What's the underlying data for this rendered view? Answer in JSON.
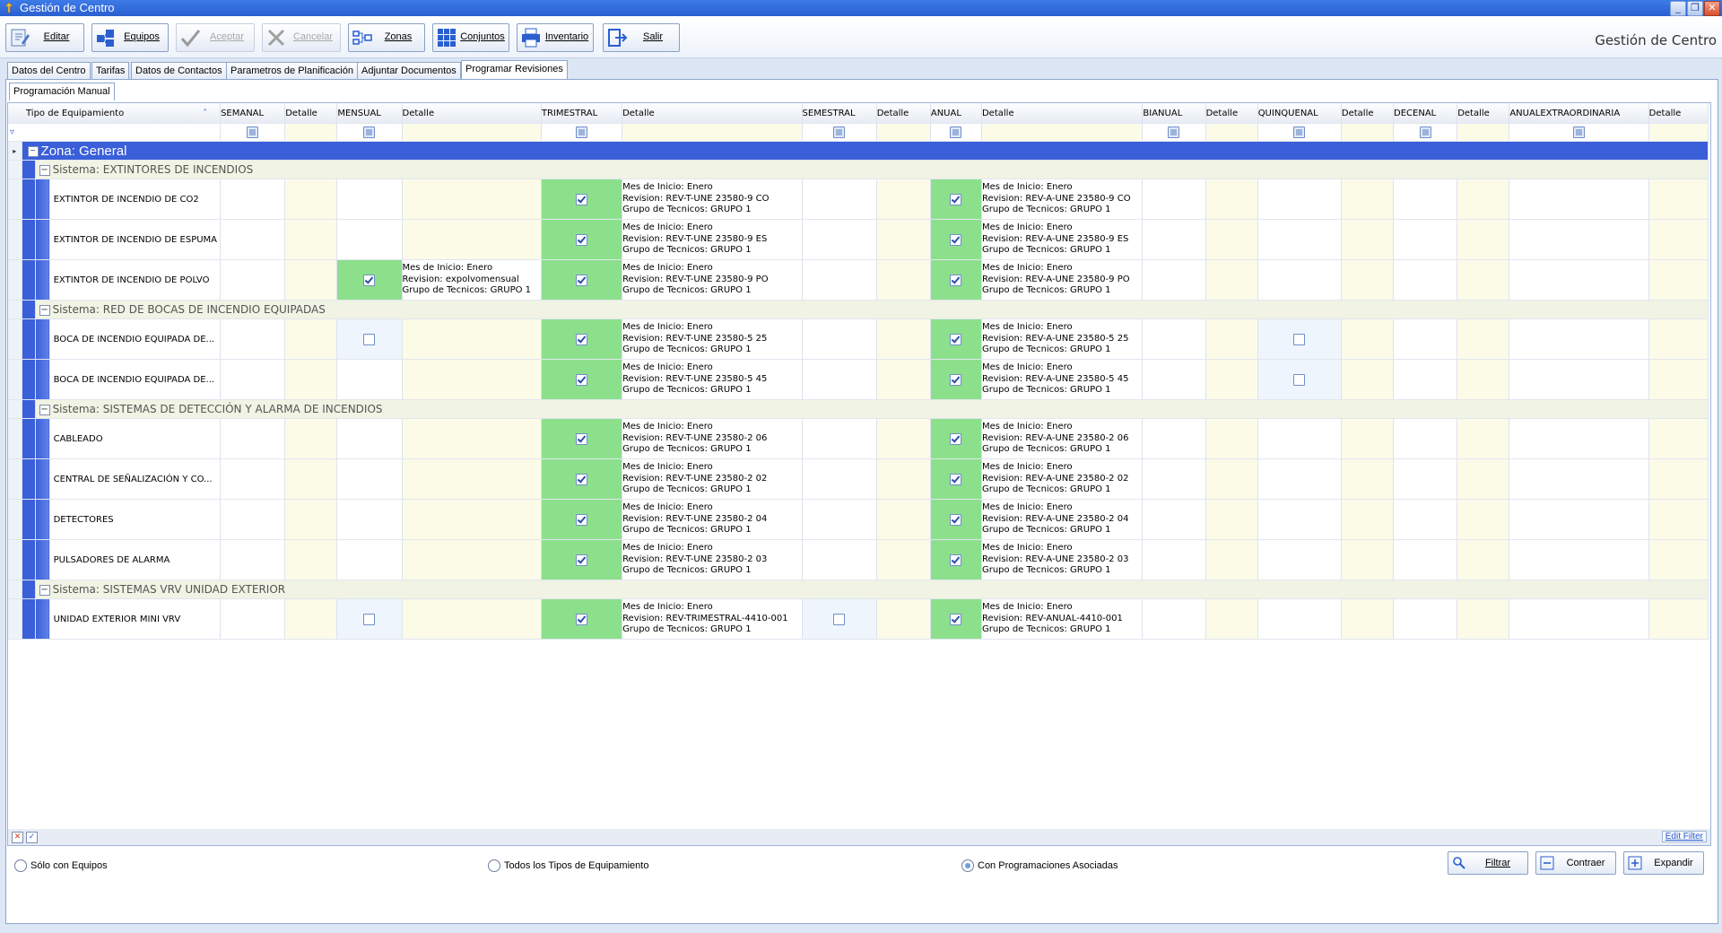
{
  "window": {
    "title": "Gestión de Centro",
    "app_heading": "Gestión de Centro"
  },
  "toolbar": [
    {
      "key": "editar",
      "label": "Editar",
      "icon": "edit-icon",
      "enabled": true
    },
    {
      "key": "equipos",
      "label": "Equipos",
      "icon": "equipment-icon",
      "enabled": true
    },
    {
      "key": "aceptar",
      "label": "Aceptar",
      "icon": "check-icon",
      "enabled": false
    },
    {
      "key": "cancelar",
      "label": "Cancelar",
      "icon": "cancel-icon",
      "enabled": false
    },
    {
      "key": "zonas",
      "label": "Zonas",
      "icon": "zones-icon",
      "enabled": true
    },
    {
      "key": "conjuntos",
      "label": "Conjuntos",
      "icon": "grid-icon",
      "enabled": true
    },
    {
      "key": "inventario",
      "label": "Inventario",
      "icon": "printer-icon",
      "enabled": true
    },
    {
      "key": "salir",
      "label": "Salir",
      "icon": "exit-icon",
      "enabled": true
    }
  ],
  "tabs": [
    "Datos del Centro",
    "Tarifas",
    "Datos de Contactos",
    "Parametros de Planificación",
    "Adjuntar Documentos",
    "Programar Revisiones"
  ],
  "active_tab": "Programar Revisiones",
  "subtab": "Programación Manual",
  "grid": {
    "headers": {
      "tipo": "Tipo de Equipamiento",
      "semanal": "SEMANAL",
      "semanal_det": "Detalle",
      "mensual": "MENSUAL",
      "mensual_det": "Detalle",
      "trimestral": "TRIMESTRAL",
      "trimestral_det": "Detalle",
      "semestral": "SEMESTRAL",
      "semestral_det": "Detalle",
      "anual": "ANUAL",
      "anual_det": "Detalle",
      "bianual": "BIANUAL",
      "bianual_det": "Detalle",
      "quinquenal": "QUINQUENAL",
      "quinquenal_det": "Detalle",
      "decenal": "DECENAL",
      "decenal_det": "Detalle",
      "anualextra": "ANUALEXTRAORDINARIA",
      "anualextra_det": "Detalle"
    },
    "zone": "Zona: General",
    "systems": [
      "Sistema: EXTINTORES DE INCENDIOS",
      "Sistema: RED DE BOCAS DE INCENDIO EQUIPADAS",
      "Sistema: SISTEMAS DE DETECCIÓN Y ALARMA DE INCENDIOS",
      "Sistema: SISTEMAS VRV UNIDAD EXTERIOR"
    ],
    "rows": [
      {
        "name": "EXTINTOR DE INCENDIO DE CO2",
        "trimestral": [
          "Mes de Inicio: Enero",
          "Revision: REV-T-UNE 23580-9 CO",
          "Grupo de Tecnicos: GRUPO 1"
        ],
        "anual": [
          "Mes de Inicio: Enero",
          "Revision: REV-A-UNE 23580-9 CO",
          "Grupo de Tecnicos: GRUPO 1"
        ]
      },
      {
        "name": "EXTINTOR DE INCENDIO DE ESPUMA",
        "trimestral": [
          "Mes de Inicio: Enero",
          "Revision: REV-T-UNE 23580-9 ES",
          "Grupo de Tecnicos: GRUPO 1"
        ],
        "anual": [
          "Mes de Inicio: Enero",
          "Revision: REV-A-UNE 23580-9 ES",
          "Grupo de Tecnicos: GRUPO 1"
        ]
      },
      {
        "name": "EXTINTOR DE INCENDIO DE POLVO",
        "mensual": [
          "Mes de Inicio: Enero",
          "Revision: expolvomensual",
          "Grupo de Tecnicos: GRUPO 1"
        ],
        "trimestral": [
          "Mes de Inicio: Enero",
          "Revision: REV-T-UNE 23580-9 PO",
          "Grupo de Tecnicos: GRUPO 1"
        ],
        "anual": [
          "Mes de Inicio: Enero",
          "Revision: REV-A-UNE 23580-9 PO",
          "Grupo de Tecnicos: GRUPO 1"
        ]
      },
      {
        "name": "BOCA DE INCENDIO EQUIPADA DE...",
        "trimestral": [
          "Mes de Inicio: Enero",
          "Revision: REV-T-UNE 23580-5 25",
          "Grupo de Tecnicos: GRUPO 1"
        ],
        "anual": [
          "Mes de Inicio: Enero",
          "Revision: REV-A-UNE 23580-5 25",
          "Grupo de Tecnicos: GRUPO 1"
        ]
      },
      {
        "name": "BOCA DE INCENDIO EQUIPADA DE...",
        "trimestral": [
          "Mes de Inicio: Enero",
          "Revision: REV-T-UNE 23580-5 45",
          "Grupo de Tecnicos: GRUPO 1"
        ],
        "anual": [
          "Mes de Inicio: Enero",
          "Revision: REV-A-UNE 23580-5 45",
          "Grupo de Tecnicos: GRUPO 1"
        ]
      },
      {
        "name": "CABLEADO",
        "trimestral": [
          "Mes de Inicio: Enero",
          "Revision: REV-T-UNE 23580-2 06",
          "Grupo de Tecnicos: GRUPO 1"
        ],
        "anual": [
          "Mes de Inicio: Enero",
          "Revision: REV-A-UNE 23580-2 06",
          "Grupo de Tecnicos: GRUPO 1"
        ]
      },
      {
        "name": "CENTRAL DE SEÑALIZACIÓN Y CO...",
        "trimestral": [
          "Mes de Inicio: Enero",
          "Revision: REV-T-UNE 23580-2 02",
          "Grupo de Tecnicos: GRUPO 1"
        ],
        "anual": [
          "Mes de Inicio: Enero",
          "Revision: REV-A-UNE 23580-2 02",
          "Grupo de Tecnicos: GRUPO 1"
        ]
      },
      {
        "name": "DETECTORES",
        "trimestral": [
          "Mes de Inicio: Enero",
          "Revision: REV-T-UNE 23580-2 04",
          "Grupo de Tecnicos: GRUPO 1"
        ],
        "anual": [
          "Mes de Inicio: Enero",
          "Revision: REV-A-UNE 23580-2 04",
          "Grupo de Tecnicos: GRUPO 1"
        ]
      },
      {
        "name": "PULSADORES DE ALARMA",
        "trimestral": [
          "Mes de Inicio: Enero",
          "Revision: REV-T-UNE 23580-2 03",
          "Grupo de Tecnicos: GRUPO 1"
        ],
        "anual": [
          "Mes de Inicio: Enero",
          "Revision: REV-A-UNE 23580-2 03",
          "Grupo de Tecnicos: GRUPO 1"
        ]
      },
      {
        "name": "UNIDAD EXTERIOR MINI VRV",
        "trimestral": [
          "Mes de Inicio: Enero",
          "Revision: REV-TRIMESTRAL-4410-001",
          "Grupo de Tecnicos: GRUPO 1"
        ],
        "anual": [
          "Mes de Inicio: Enero",
          "Revision: REV-ANUAL-4410-001",
          "Grupo de Tecnicos: GRUPO 1"
        ]
      }
    ]
  },
  "filter_bar": {
    "edit_filter": "Edit Filter"
  },
  "options": {
    "radio1": "Sólo con Equipos",
    "radio2": "Todos los Tipos de Equipamiento",
    "radio3": "Con Programaciones Asociadas",
    "selected": "Con Programaciones Asociadas"
  },
  "buttons": {
    "filtrar": "Filtrar",
    "contraer": "Contraer",
    "expandir": "Expandir"
  },
  "colors": {
    "zone_band": "#3a5fd9",
    "checked_cell": "#8ce08c",
    "detail_yellow": "#fbfbe8"
  }
}
